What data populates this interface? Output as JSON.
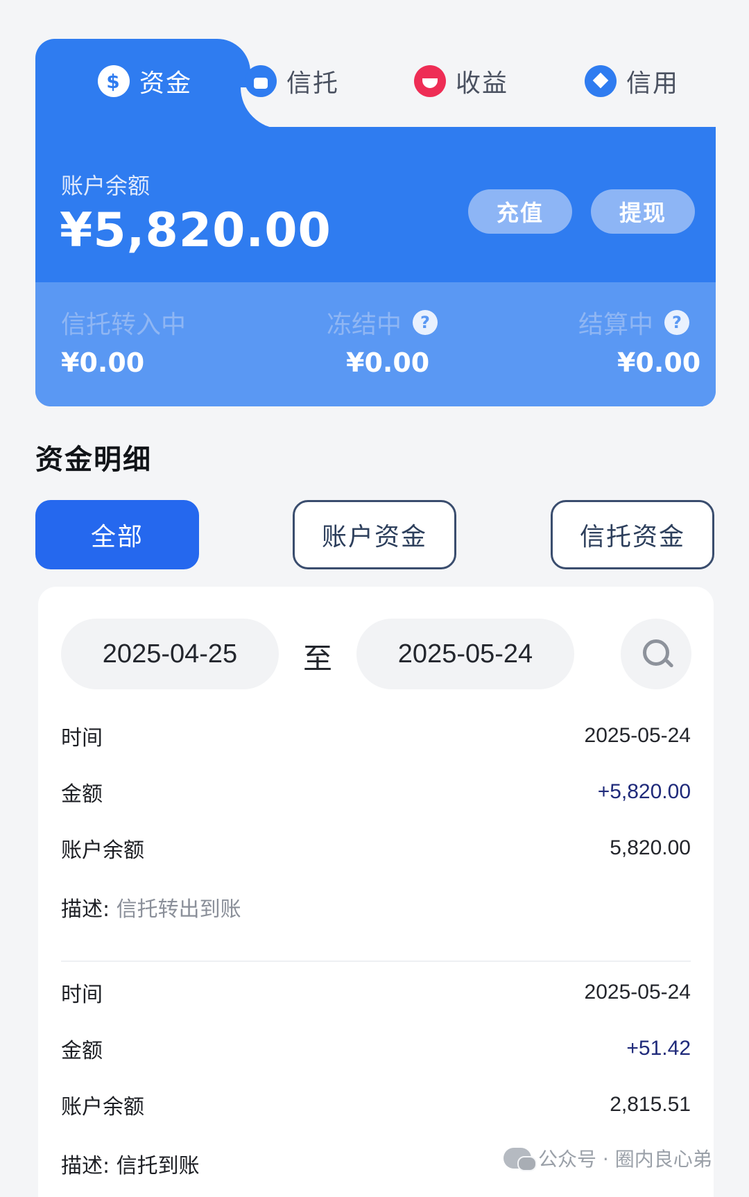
{
  "tabs": [
    {
      "label": "资金",
      "icon": "dollar-icon",
      "active": true
    },
    {
      "label": "信托",
      "icon": "bag-icon",
      "active": false
    },
    {
      "label": "收益",
      "icon": "smile-icon",
      "active": false
    },
    {
      "label": "信用",
      "icon": "heart-icon",
      "active": false
    }
  ],
  "balance": {
    "label": "账户余额",
    "value": "¥5,820.00",
    "recharge_label": "充值",
    "withdraw_label": "提现"
  },
  "stats": [
    {
      "label": "信托转入中",
      "value": "¥0.00"
    },
    {
      "label": "冻结中",
      "value": "¥0.00"
    },
    {
      "label": "结算中",
      "value": "¥0.00"
    }
  ],
  "detail": {
    "title": "资金明细",
    "filters": [
      "全部",
      "账户资金",
      "信托资金"
    ],
    "date_from": "2025-04-25",
    "date_sep": "至",
    "date_to": "2025-05-24"
  },
  "records": [
    {
      "time_label": "时间",
      "time": "2025-05-24",
      "amount_label": "金额",
      "amount": "+5,820.00",
      "balance_label": "账户余额",
      "balance": "5,820.00",
      "desc_label": "描述:",
      "desc": "信托转出到账"
    },
    {
      "time_label": "时间",
      "time": "2025-05-24",
      "amount_label": "金额",
      "amount": "+51.42",
      "balance_label": "账户余额",
      "balance": "2,815.51",
      "desc_label": "描述:",
      "desc": "信托到账"
    }
  ],
  "watermark": "公众号 · 圈内良心弟",
  "colors": {
    "primary": "#2f7cf0",
    "filter_active": "#2568ee",
    "accent_red": "#ee2d55"
  }
}
